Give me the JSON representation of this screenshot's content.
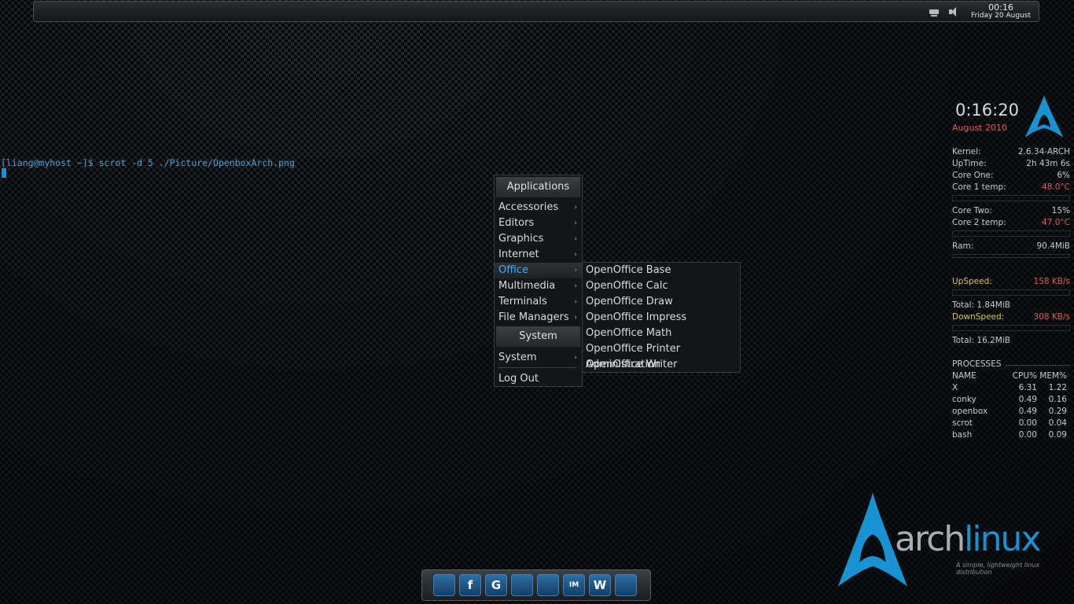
{
  "top_panel": {
    "clock_time": "00:16",
    "clock_date": "Friday 20 August"
  },
  "terminal": {
    "prompt_line": "[liang@myhost ~]$ scrot -d 5 ./Picture/OpenboxArch.png"
  },
  "app_menu": {
    "header": "Applications",
    "items": [
      {
        "label": "Accessories",
        "arrow": "›"
      },
      {
        "label": "Editors",
        "arrow": "›"
      },
      {
        "label": "Graphics",
        "arrow": "›"
      },
      {
        "label": "Internet",
        "arrow": "›"
      },
      {
        "label": "Office",
        "arrow": "›"
      },
      {
        "label": "Multimedia",
        "arrow": "›"
      },
      {
        "label": "Terminals",
        "arrow": "›"
      },
      {
        "label": "File Managers",
        "arrow": "›"
      }
    ],
    "active_item": "Office",
    "system_header": "System",
    "system_item": {
      "label": "System",
      "arrow": "›"
    },
    "logout": "Log Out"
  },
  "office_submenu": {
    "items": [
      "OpenOffice Base",
      "OpenOffice Calc",
      "OpenOffice Draw",
      "OpenOffice Impress",
      "OpenOffice Math",
      "OpenOffice Printer Administration",
      "OpenOffice Writer"
    ]
  },
  "conky": {
    "time": "0:16:20",
    "month": "August 2010",
    "kernel_label": "Kernel:",
    "kernel": "2.6.34-ARCH",
    "uptime_label": "UpTime:",
    "uptime": "2h 43m 6s",
    "core1_label": "Core One:",
    "core1": "6%",
    "core1_temp_label": "Core 1 temp:",
    "core1_temp": "48.0°C",
    "core2_label": "Core Two:",
    "core2": "15%",
    "core2_temp_label": "Core 2 temp:",
    "core2_temp": "47.0°C",
    "ram_label": "Ram:",
    "ram": "90.4MiB",
    "upspeed_label": "UpSpeed:",
    "upspeed": "158   KB/s",
    "total_up": "Total: 1.84MiB",
    "downspeed_label": "DownSpeed:",
    "downspeed": "308   KB/s",
    "total_down": "Total: 16.2MiB",
    "processes_title": "PROCESSES",
    "proc_header": [
      "NAME",
      "CPU%",
      "MEM%"
    ],
    "processes": [
      [
        "X",
        "6.31",
        "1.22"
      ],
      [
        "conky",
        "0.49",
        "0.16"
      ],
      [
        "openbox",
        "0.49",
        "0.29"
      ],
      [
        "scrot",
        "0.00",
        "0.04"
      ],
      [
        "bash",
        "0.00",
        "0.09"
      ]
    ]
  },
  "wallpaper": {
    "wordmark_arch": "arch",
    "wordmark_linux": "linux",
    "tagline": "A simple, lightweight linux distribution"
  },
  "dock": {
    "icons": [
      {
        "name": "finder-icon",
        "glyph": ""
      },
      {
        "name": "facebook-icon",
        "glyph": "f"
      },
      {
        "name": "google-icon",
        "glyph": "G"
      },
      {
        "name": "mail-icon",
        "glyph": ""
      },
      {
        "name": "terminal-icon",
        "glyph": ""
      },
      {
        "name": "chat-icon",
        "glyph": "IM"
      },
      {
        "name": "writer-icon",
        "glyph": "W"
      },
      {
        "name": "device-icon",
        "glyph": ""
      }
    ]
  },
  "colors": {
    "arch_blue": "#1793d1",
    "menu_active": "#33b6ff",
    "alert_red": "#e05c55",
    "label_gold": "#d6c35c"
  }
}
